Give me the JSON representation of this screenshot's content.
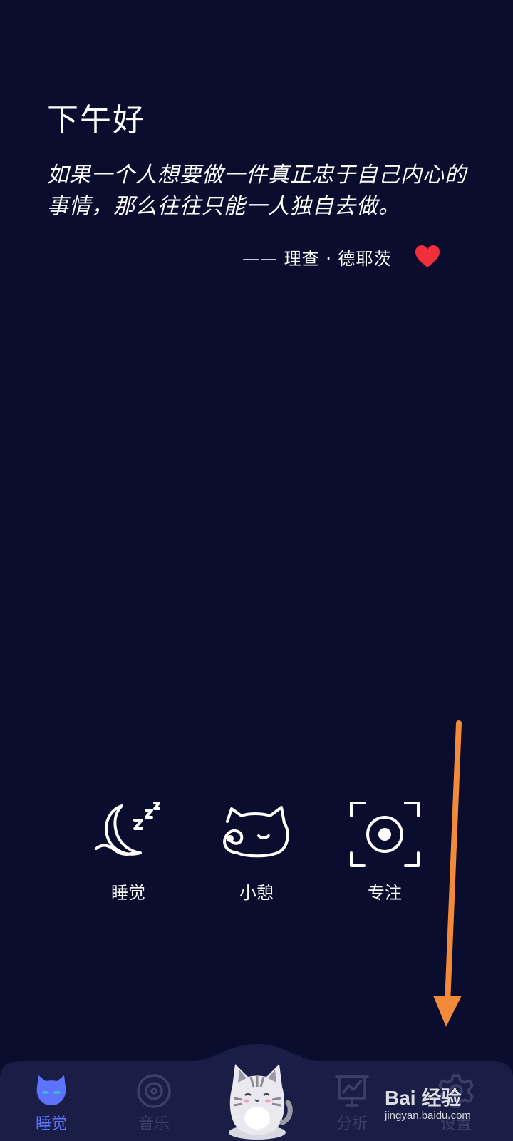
{
  "greeting": "下午好",
  "quote": {
    "text": "如果一个人想要做一件真正忠于自己内心的事情，那么往往只能一人独自去做。",
    "author": "—— 理查 · 德耶茨"
  },
  "modes": [
    {
      "label": "睡觉",
      "icon": "moon-sleep-icon"
    },
    {
      "label": "小憩",
      "icon": "cat-nap-icon"
    },
    {
      "label": "专注",
      "icon": "focus-target-icon"
    }
  ],
  "tabs": [
    {
      "label": "睡觉",
      "icon": "cat-face-icon",
      "active": true
    },
    {
      "label": "音乐",
      "icon": "vinyl-disc-icon",
      "active": false
    },
    {
      "label": "",
      "icon": "cat-mascot-icon",
      "active": false
    },
    {
      "label": "分析",
      "icon": "chart-board-icon",
      "active": false
    },
    {
      "label": "设置",
      "icon": "gear-icon",
      "active": false
    }
  ],
  "watermark": {
    "brand": "Bai 经验",
    "url": "jingyan.baidu.com"
  },
  "colors": {
    "background": "#0b0d2e",
    "tabbar": "#1a1d45",
    "accent": "#5d72ff",
    "heart": "#ef2f3c",
    "arrow": "#f28a3a",
    "inactive_tab": "#3b4068"
  }
}
